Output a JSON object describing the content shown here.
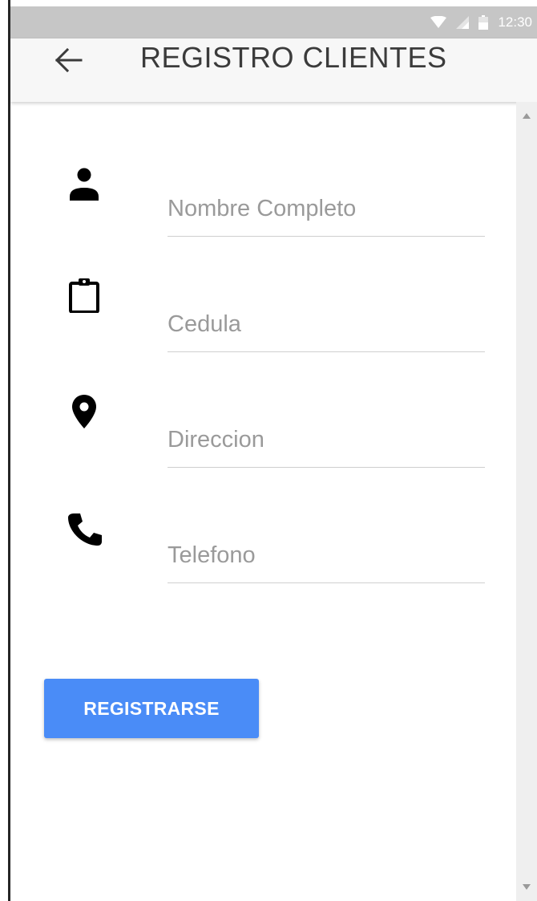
{
  "status_bar": {
    "time": "12:30",
    "icons": [
      "wifi-icon",
      "signal-icon",
      "battery-icon"
    ]
  },
  "toolbar": {
    "back_icon": "arrow-left-icon",
    "title": "REGISTRO CLIENTES"
  },
  "form": {
    "fields": [
      {
        "icon": "person-icon",
        "placeholder": "Nombre Completo",
        "value": ""
      },
      {
        "icon": "clipboard-icon",
        "placeholder": "Cedula",
        "value": ""
      },
      {
        "icon": "location-pin-icon",
        "placeholder": "Direccion",
        "value": ""
      },
      {
        "icon": "phone-icon",
        "placeholder": "Telefono",
        "value": ""
      }
    ],
    "submit_label": "REGISTRARSE"
  },
  "colors": {
    "button": "#4a8cf7",
    "status_bar": "#c6c6c6",
    "toolbar": "#f7f7f7",
    "placeholder": "#9a9a9a"
  }
}
